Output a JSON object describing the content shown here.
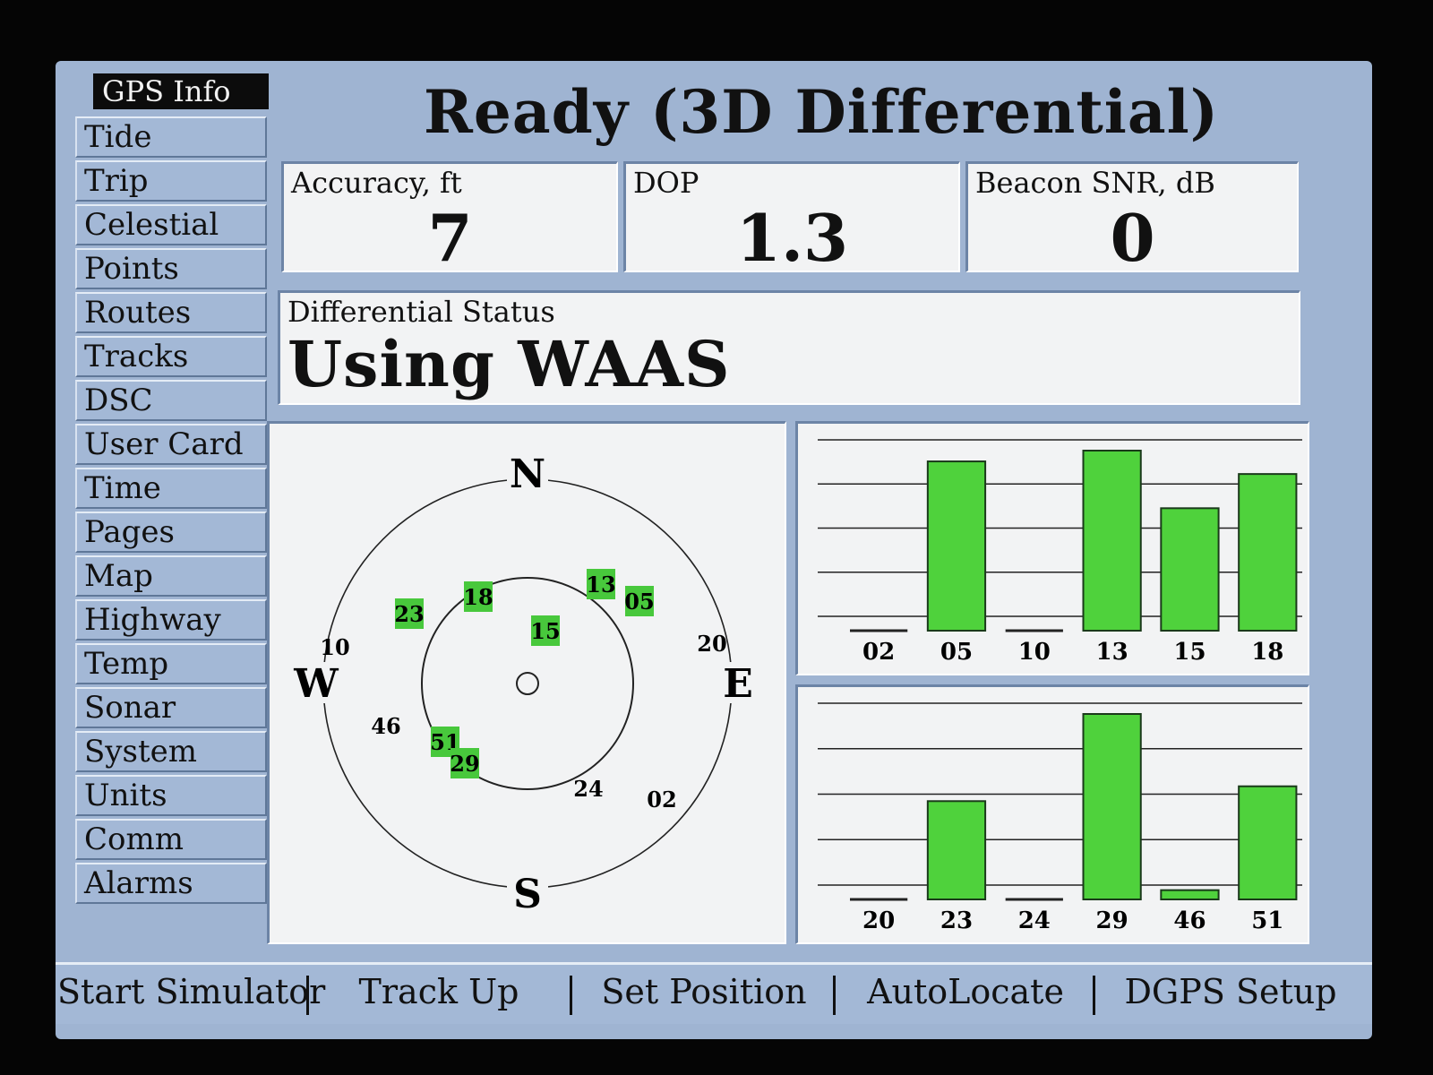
{
  "sidebar": {
    "items": [
      {
        "label": "GPS Info",
        "active": true
      },
      {
        "label": "Tide"
      },
      {
        "label": "Trip"
      },
      {
        "label": "Celestial"
      },
      {
        "label": "Points"
      },
      {
        "label": "Routes"
      },
      {
        "label": "Tracks"
      },
      {
        "label": "DSC"
      },
      {
        "label": "User Card"
      },
      {
        "label": "Time"
      },
      {
        "label": "Pages"
      },
      {
        "label": "Map"
      },
      {
        "label": "Highway"
      },
      {
        "label": "Temp"
      },
      {
        "label": "Sonar"
      },
      {
        "label": "System"
      },
      {
        "label": "Units"
      },
      {
        "label": "Comm"
      },
      {
        "label": "Alarms"
      }
    ]
  },
  "header": {
    "title": "Ready (3D Differential)"
  },
  "fields": {
    "accuracy": {
      "label": "Accuracy, ft",
      "value": "7"
    },
    "dop": {
      "label": "DOP",
      "value": "1.3"
    },
    "beacon": {
      "label": "Beacon SNR, dB",
      "value": "0"
    }
  },
  "differential": {
    "label": "Differential Status",
    "value": "Using WAAS"
  },
  "skyview": {
    "directions": {
      "n": "N",
      "e": "E",
      "s": "S",
      "w": "W"
    },
    "satellites": [
      {
        "id": "23",
        "tracked": true
      },
      {
        "id": "18",
        "tracked": true
      },
      {
        "id": "13",
        "tracked": true
      },
      {
        "id": "05",
        "tracked": true
      },
      {
        "id": "15",
        "tracked": true
      },
      {
        "id": "51",
        "tracked": true
      },
      {
        "id": "29",
        "tracked": true
      },
      {
        "id": "10",
        "tracked": false
      },
      {
        "id": "20",
        "tracked": false
      },
      {
        "id": "46",
        "tracked": false
      },
      {
        "id": "24",
        "tracked": false
      },
      {
        "id": "02",
        "tracked": false
      }
    ]
  },
  "chart_data": [
    {
      "type": "bar",
      "categories": [
        "02",
        "05",
        "10",
        "13",
        "15",
        "18"
      ],
      "values": [
        0,
        0.94,
        0,
        1.0,
        0.68,
        0.87
      ],
      "ylim": [
        0,
        1
      ],
      "grid": true
    },
    {
      "type": "bar",
      "categories": [
        "20",
        "23",
        "24",
        "29",
        "46",
        "51"
      ],
      "values": [
        0,
        0.53,
        0,
        1.0,
        0.05,
        0.61
      ],
      "ylim": [
        0,
        1
      ],
      "grid": true
    }
  ],
  "softkeys": [
    {
      "label": "Start Simulator"
    },
    {
      "label": "Track Up"
    },
    {
      "label": "Set Position"
    },
    {
      "label": "AutoLocate"
    },
    {
      "label": "DGPS Setup"
    }
  ],
  "colors": {
    "satellite_green": "#48c83c",
    "bar_green": "#4fd23c",
    "panel_blue": "#9fb4d2",
    "panel_white": "#f2f3f4"
  }
}
